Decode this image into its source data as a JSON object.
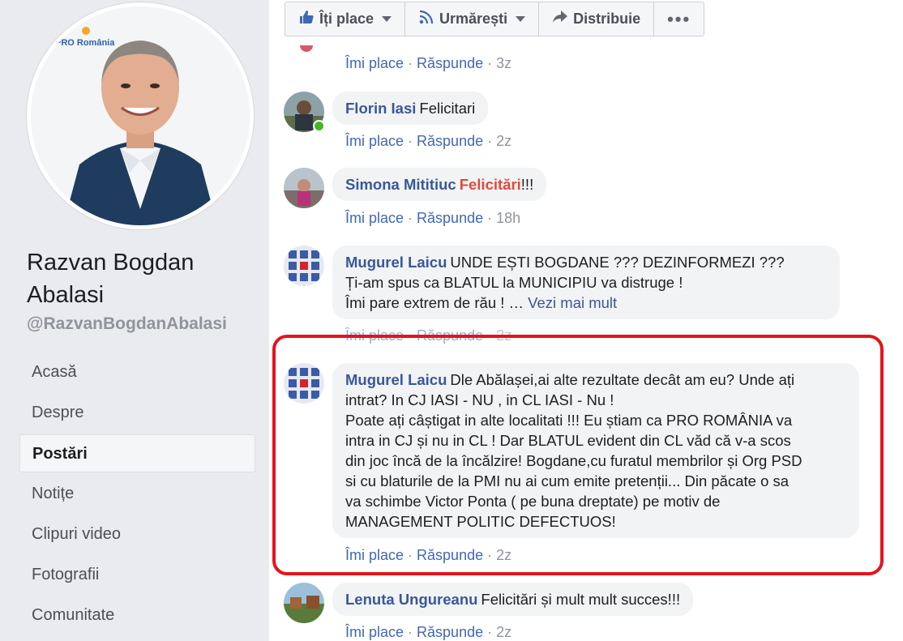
{
  "page": {
    "name": "Razvan Bogdan Abalasi",
    "handle": "@RazvanBogdanAbalasi",
    "logo_text": "PRO România"
  },
  "nav": {
    "items": [
      {
        "label": "Acasă"
      },
      {
        "label": "Despre"
      },
      {
        "label": "Postări"
      },
      {
        "label": "Notițe"
      },
      {
        "label": "Clipuri video"
      },
      {
        "label": "Fotografii"
      },
      {
        "label": "Comunitate"
      }
    ],
    "active_index": 2
  },
  "action_bar": {
    "like": "Îți place",
    "follow": "Urmărești",
    "share": "Distribuie"
  },
  "comment_actions": {
    "like": "Îmi place",
    "reply": "Răspunde"
  },
  "top_meta": {
    "time": "3z"
  },
  "comments": [
    {
      "author": "Florin Iasi",
      "text": "Felicitari",
      "time": "2z",
      "online": true
    },
    {
      "author": "Simona Mititiuc",
      "text_emph": "Felicitări",
      "text": "!!!",
      "time": "18h"
    },
    {
      "author": "Mugurel Laicu",
      "line1": "UNDE EȘTI BOGDANE ??? DEZINFORMEZI ???",
      "line2": "Ți-am spus ca BLATUL la MUNICIPIU va distruge !",
      "line3": "Îmi pare extrem de rău ! …",
      "see_more": "Vezi mai mult",
      "time": "2z"
    },
    {
      "author": "Mugurel Laicu",
      "line1": "Dle Abălașei,ai alte rezultate decât am eu? Unde ați",
      "line2": "intrat? In CJ IASI - NU , in CL IASI - Nu !",
      "line3": "Poate ați câștigat in alte localitati !!! Eu știam ca PRO ROMÂNIA va",
      "line4": "intra in CJ și nu in CL ! Dar BLATUL evident din CL văd că v-a scos",
      "line5": "din joc încă de la încălzire! Bogdane,cu furatul membrilor și Org PSD",
      "line6": "si cu blaturile de la PMI nu ai cum emite pretenții... Din păcate o sa",
      "line7": "va schimbe Victor Ponta ( pe buna dreptate) pe motiv de",
      "line8": "MANAGEMENT POLITIC DEFECTUOS!",
      "time": "2z"
    },
    {
      "author": "Lenuta Ungureanu",
      "text": "Felicitări și mult mult succes!!!",
      "time": "2z"
    }
  ],
  "colors": {
    "highlight": "#e3141c",
    "author_link": "#385898",
    "bubble": "#f2f3f5",
    "background": "#e9ebee"
  }
}
